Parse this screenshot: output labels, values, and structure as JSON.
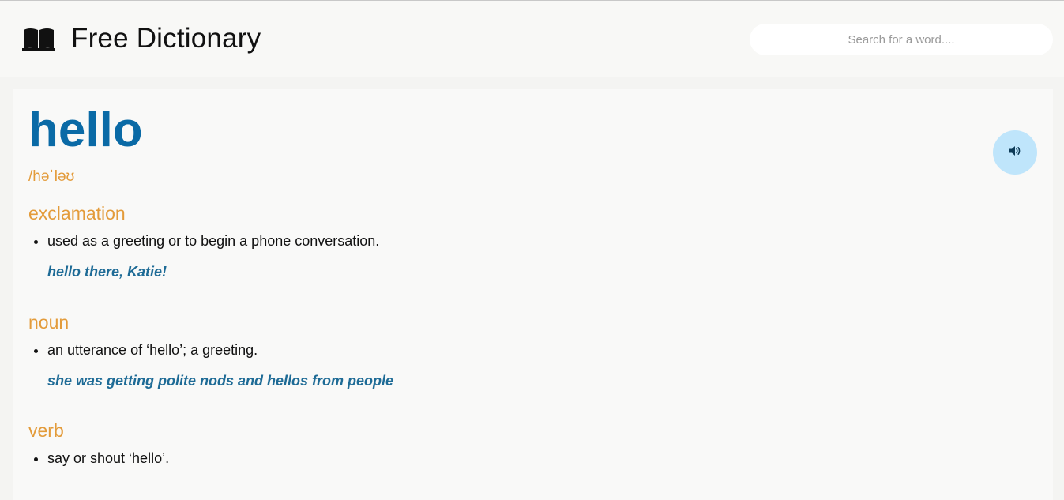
{
  "header": {
    "icon": "open-book-icon",
    "title": "Free Dictionary"
  },
  "search": {
    "placeholder": "Search for a word....",
    "value": ""
  },
  "entry": {
    "word": "hello",
    "phonetic": "/həˈləʊ",
    "audio_icon": "speaker-icon",
    "meanings": [
      {
        "part_of_speech": "exclamation",
        "definition": "used as a greeting or to begin a phone conversation.",
        "example": "hello there, Katie!"
      },
      {
        "part_of_speech": "noun",
        "definition": "an utterance of ‘hello’; a greeting.",
        "example": "she was getting polite nods and hellos from people"
      },
      {
        "part_of_speech": "verb",
        "definition": "say or shout ‘hello’.",
        "example": ""
      }
    ]
  },
  "colors": {
    "word": "#0a6aa6",
    "accent": "#e39b3a",
    "example": "#1e6b96",
    "audio_button_bg": "#bfe5fb"
  }
}
